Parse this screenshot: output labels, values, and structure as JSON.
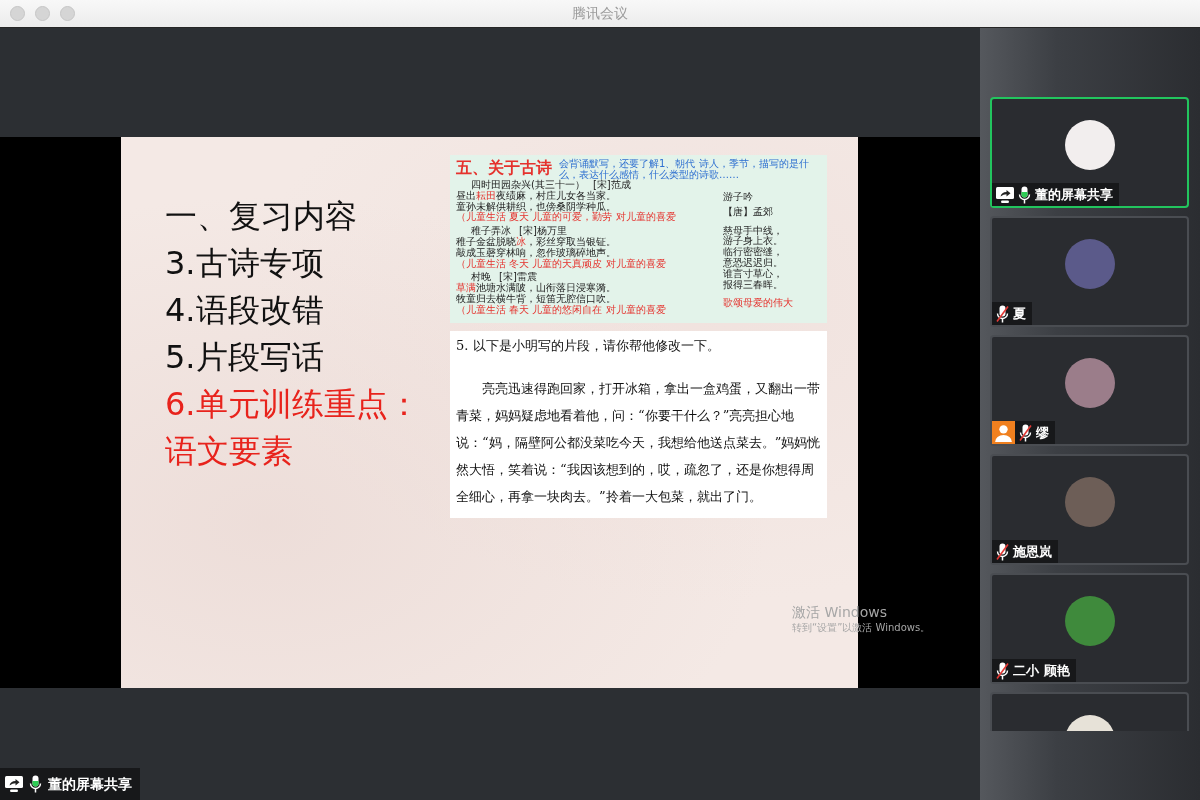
{
  "window": {
    "title": "腾讯会议"
  },
  "shared_screen": {
    "slide": {
      "outline": [
        {
          "text": "一、复习内容",
          "kind": "heading",
          "highlighted": false
        },
        {
          "text": "3.古诗专项",
          "kind": "item",
          "highlighted": false
        },
        {
          "text": "4.语段改错",
          "kind": "item",
          "highlighted": false
        },
        {
          "text": "5.片段写话",
          "kind": "item",
          "highlighted": false
        },
        {
          "text": "6.单元训练重点：",
          "kind": "item",
          "highlighted": true
        },
        {
          "text": "语文要素",
          "kind": "item",
          "highlighted": true
        }
      ],
      "poem_panel": {
        "title": "五、关于古诗",
        "note": "会背诵默写，还要了解1、朝代 诗人，季节，描写的是什么，表达什么感情，什么类型的诗歌……",
        "poems": [
          {
            "title": "四时田园杂兴(其三十一）",
            "author": "[宋]范成",
            "lines": [
              [
                {
                  "text": "昼出",
                  "emphasis": false
                },
                {
                  "text": "耘田",
                  "emphasis": true
                },
                {
                  "text": "夜绩麻，村庄儿女各当家。",
                  "emphasis": false
                }
              ],
              [
                {
                  "text": "童孙未解供耕织，也傍桑阴学种瓜。",
                  "emphasis": false
                }
              ]
            ],
            "theme": "（儿童生活 夏天 儿童的可爱，勤劳 对儿童的喜爱"
          },
          {
            "title": "稚子弄冰",
            "author": "[宋]杨万里",
            "lines": [
              [
                {
                  "text": "稚子金盆脱晓",
                  "emphasis": false
                },
                {
                  "text": "冰",
                  "emphasis": true
                },
                {
                  "text": "，彩丝穿取当银钲。",
                  "emphasis": false
                }
              ],
              [
                {
                  "text": "敲成玉磬穿林响，忽作玻璃碎地声。",
                  "emphasis": false
                }
              ]
            ],
            "theme": "（儿童生活 冬天 儿童的天真顽皮 对儿童的喜爱"
          },
          {
            "title": "村晚",
            "author": "[宋]雷震",
            "lines": [
              [
                {
                  "text": "草满",
                  "emphasis": true
                },
                {
                  "text": "池塘水满陂，山衔落日浸寒漪。",
                  "emphasis": false
                }
              ],
              [
                {
                  "text": "牧童归去横牛背，短笛无腔信口吹。",
                  "emphasis": false
                }
              ]
            ],
            "theme": "（儿童生活 春天 儿童的悠闲自在 对儿童的喜爱"
          }
        ],
        "side_poem": {
          "title": "游子吟",
          "author": "【唐】孟郊",
          "lines": [
            "慈母手中线，",
            "游子身上衣。",
            "临行密密缝，",
            "意恐迟迟归。",
            "谁言寸草心，",
            "报得三春晖。"
          ],
          "theme": "歌颂母爱的伟大"
        }
      },
      "exercise": {
        "question": "5. 以下是小明写的片段，请你帮他修改一下。",
        "passage": "亮亮迅速得跑回家，打开冰箱，拿出一盒鸡蛋，又翻出一带青菜，妈妈疑虑地看着他，问：“你要干什么？”亮亮担心地说：“妈，隔壁阿公都没菜吃今天，我想给他送点菜去。”妈妈恍然大悟，笑着说：“我因该想到的，哎，疏忽了，还是你想得周全细心，再拿一块肉去。”拎着一大包菜，就出了门。"
      }
    },
    "activation_notice": {
      "title": "激活 Windows",
      "hint": "转到“设置”以激活 Windows。"
    }
  },
  "presenter_tag": {
    "name": "董的屏幕共享",
    "sharing": true,
    "muted": false
  },
  "participants": [
    {
      "name": "董的屏幕共享",
      "speaking": true,
      "sharing": true,
      "host": false,
      "muted": false
    },
    {
      "name": "夏",
      "speaking": false,
      "sharing": false,
      "host": false,
      "muted": true
    },
    {
      "name": "缪",
      "speaking": false,
      "sharing": false,
      "host": true,
      "muted": true
    },
    {
      "name": "施恩岚",
      "speaking": false,
      "sharing": false,
      "host": false,
      "muted": true
    },
    {
      "name": "二小 顾艳",
      "speaking": false,
      "sharing": false,
      "host": false,
      "muted": true
    },
    {
      "speaking": false
    }
  ]
}
